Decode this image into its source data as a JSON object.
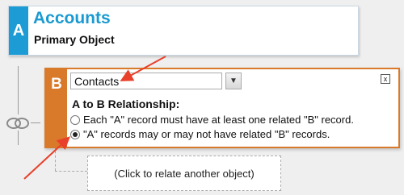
{
  "object_a": {
    "letter": "A",
    "name": "Accounts",
    "role": "Primary Object"
  },
  "object_b": {
    "letter": "B",
    "selected_object": "Contacts",
    "close_label": "x",
    "relationship_heading": "A to B Relationship:",
    "options": [
      {
        "label": "Each \"A\" record must have at least one related \"B\" record.",
        "selected": false
      },
      {
        "label": "\"A\" records may or may not have related \"B\" records.",
        "selected": true
      }
    ]
  },
  "add_object_label": "(Click to relate another object)",
  "colors": {
    "object_a_accent": "#1d9bd4",
    "object_b_accent": "#d9792a",
    "annotation_arrow": "#e8402a"
  }
}
